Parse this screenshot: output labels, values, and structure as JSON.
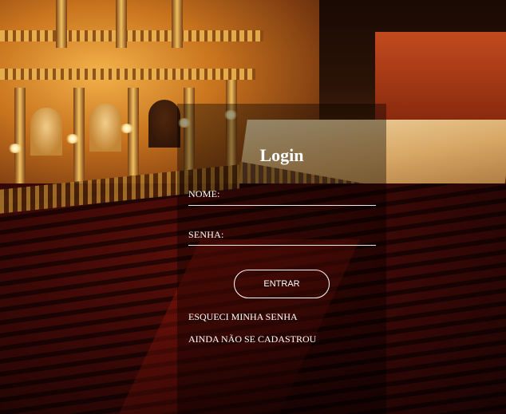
{
  "login": {
    "title": "Login",
    "name_label": "NOME:",
    "name_value": "",
    "password_label": "SENHA:",
    "password_value": "",
    "enter_button": "ENTRAR",
    "forgot_password_link": "ESQUECI MINHA SENHA",
    "register_link": "AINDA NÃO SE CADASTROU"
  },
  "colors": {
    "text": "#ffffff",
    "overlay": "rgba(0,0,0,0.38)"
  }
}
